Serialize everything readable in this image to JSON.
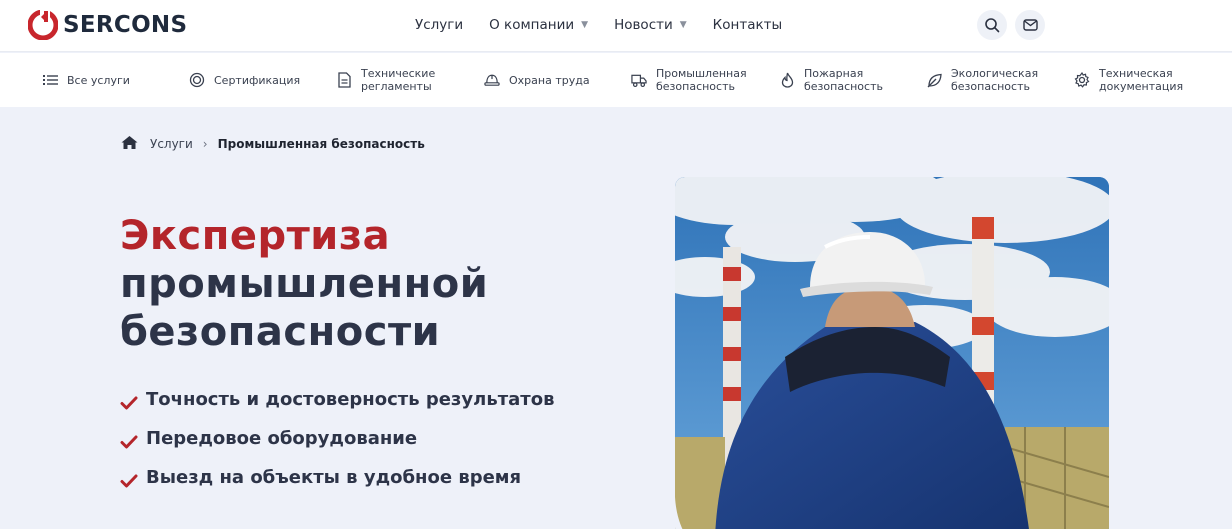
{
  "brand": {
    "name": "SERCONS",
    "color": "#c8262c"
  },
  "nav": {
    "items": [
      {
        "label": "Услуги",
        "dropdown": false
      },
      {
        "label": "О компании",
        "dropdown": true
      },
      {
        "label": "Новости",
        "dropdown": true
      },
      {
        "label": "Контакты",
        "dropdown": false
      }
    ],
    "caret": "▼"
  },
  "header_icons": {
    "search": "search-icon",
    "mail": "mail-icon"
  },
  "services": [
    {
      "label": "Все услуги",
      "icon": "list-icon"
    },
    {
      "label": "Сертификация",
      "icon": "medal-icon"
    },
    {
      "label": "Технические\nрегламенты",
      "icon": "document-icon"
    },
    {
      "label": "Охрана труда",
      "icon": "helmet-icon"
    },
    {
      "label": "Промышленная\nбезопасность",
      "icon": "truck-icon"
    },
    {
      "label": "Пожарная\nбезопасность",
      "icon": "fire-icon"
    },
    {
      "label": "Экологическая\nбезопасность",
      "icon": "leaf-icon"
    },
    {
      "label": "Техническая\nдокументация",
      "icon": "gear-icon"
    }
  ],
  "breadcrumb": {
    "home_icon": "home-icon",
    "link": "Услуги",
    "separator": "›",
    "current": "Промышленная безопасность"
  },
  "hero": {
    "title_accent": "Экспертиза",
    "title_line2": "промышленной",
    "title_line3": "безопасности",
    "features": [
      "Точность и достоверность результатов",
      "Передовое оборудование",
      "Выезд на объекты в удобное время"
    ],
    "image_icon": "industrial-worker-photo"
  },
  "colors": {
    "accent": "#b4252b",
    "text_dark": "#2d3448",
    "background": "#eef1f9"
  }
}
